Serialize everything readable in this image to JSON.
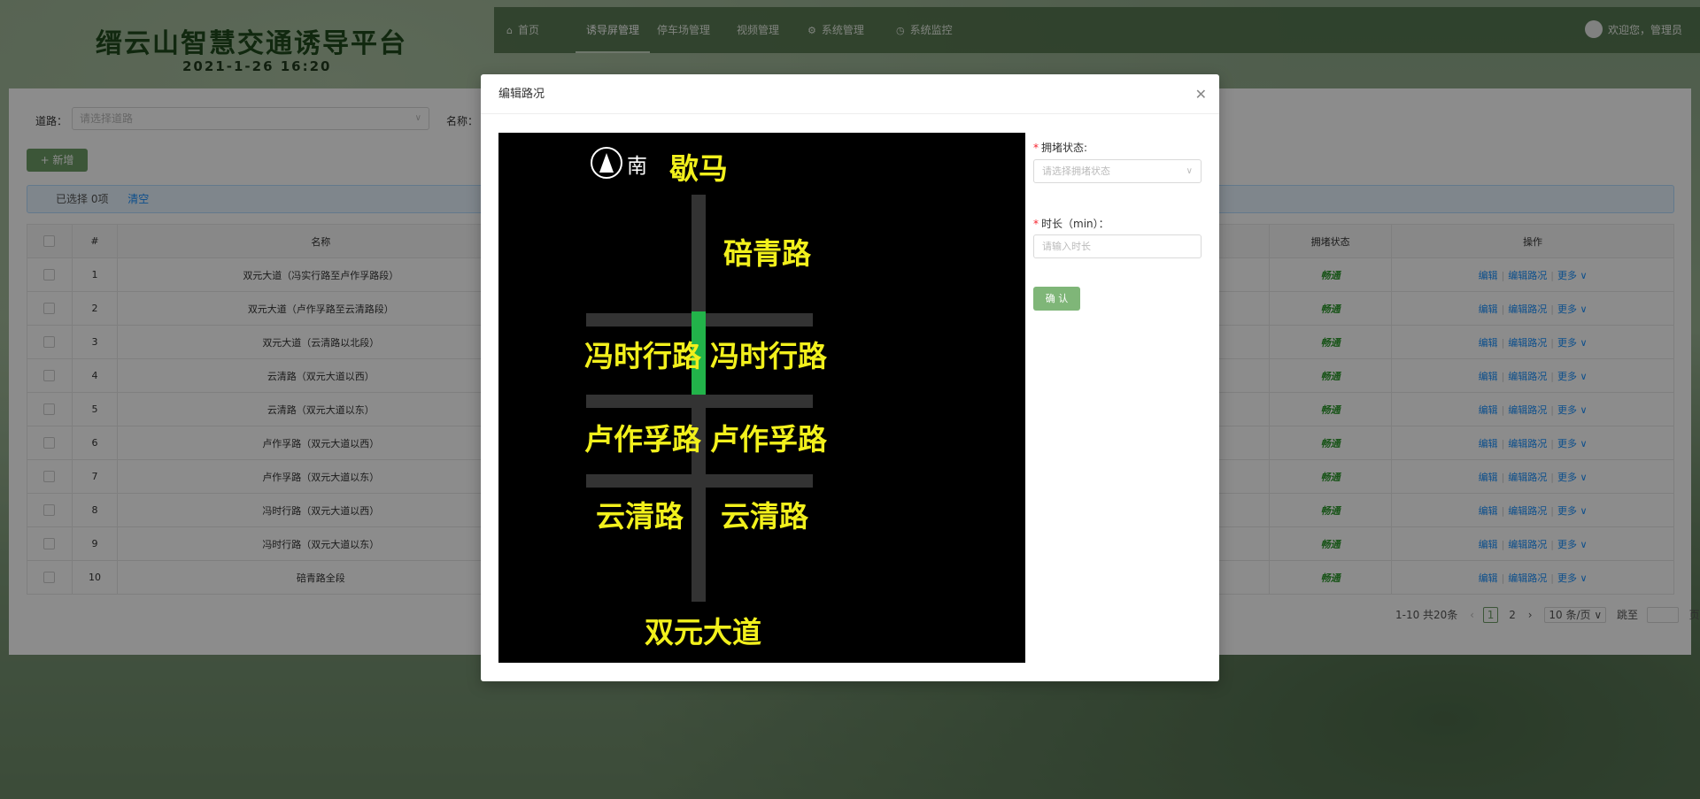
{
  "header": {
    "title": "缙云山智慧交通诱导平台",
    "datetime": "2021-1-26  16:20",
    "nav": [
      {
        "label": "首页",
        "icon": "home-icon"
      },
      {
        "label": "诱导屏管理",
        "icon": ""
      },
      {
        "label": "停车场管理",
        "icon": ""
      },
      {
        "label": "视频管理",
        "icon": ""
      },
      {
        "label": "系统管理",
        "icon": "gear-icon"
      },
      {
        "label": "系统监控",
        "icon": "dashboard-icon"
      }
    ],
    "user": "欢迎您，管理员"
  },
  "filters": {
    "road_label": "道路：",
    "road_placeholder": "请选择道路",
    "name_label": "名称："
  },
  "toolbar": {
    "add_label": "+ 新增"
  },
  "selection": {
    "text": "已选择 0项",
    "clear": "清空"
  },
  "table": {
    "headers": [
      "#",
      "名称",
      "拥堵状态",
      "操作"
    ],
    "rows": [
      {
        "no": "1",
        "name": "双元大道（冯实行路至卢作孚路段）",
        "status": "畅通"
      },
      {
        "no": "2",
        "name": "双元大道（卢作孚路至云清路段）",
        "status": "畅通"
      },
      {
        "no": "3",
        "name": "双元大道（云清路以北段）",
        "status": "畅通"
      },
      {
        "no": "4",
        "name": "云清路（双元大道以西）",
        "status": "畅通"
      },
      {
        "no": "5",
        "name": "云清路（双元大道以东）",
        "status": "畅通"
      },
      {
        "no": "6",
        "name": "卢作孚路（双元大道以西）",
        "status": "畅通"
      },
      {
        "no": "7",
        "name": "卢作孚路（双元大道以东）",
        "status": "畅通"
      },
      {
        "no": "8",
        "name": "冯时行路（双元大道以西）",
        "status": "畅通"
      },
      {
        "no": "9",
        "name": "冯时行路（双元大道以东）",
        "status": "畅通"
      },
      {
        "no": "10",
        "name": "碚青路全段",
        "status": "畅通"
      }
    ],
    "actions": {
      "edit": "编辑",
      "edit_road": "编辑路况",
      "more": "更多"
    }
  },
  "pager": {
    "total": "1-10 共20条",
    "pages": [
      "1",
      "2"
    ],
    "current": "1",
    "page_size": "10 条/页",
    "jump_label": "跳至",
    "page_unit": "页"
  },
  "modal": {
    "title": "编辑路况",
    "map": {
      "compass_dir": "南",
      "labels": {
        "top": "歇马",
        "north_road": "碚青路",
        "fsx_w": "冯时行路",
        "fsx_e": "冯时行路",
        "lzf_w": "卢作孚路",
        "lzf_e": "卢作孚路",
        "yq_w": "云清路",
        "yq_e": "云清路",
        "bottom": "双元大道"
      },
      "colors": {
        "road": "#333333",
        "highlight": "#22b34a",
        "label": "#f2f01c"
      }
    },
    "form": {
      "status_label": "拥堵状态:",
      "status_placeholder": "请选择拥堵状态",
      "duration_label": "时长（min）：",
      "duration_placeholder": "请输入时长",
      "confirm": "确 认"
    }
  }
}
